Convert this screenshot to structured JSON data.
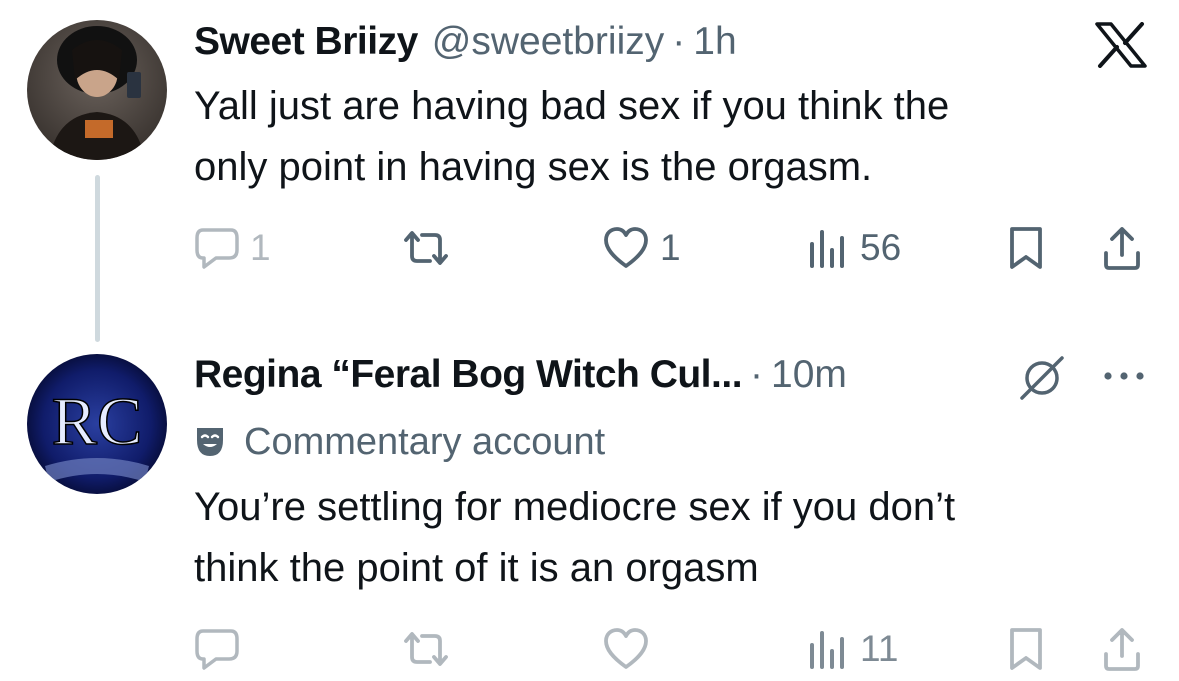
{
  "tweet1": {
    "name": "Sweet Briizy",
    "handle": "@sweetbriizy",
    "time": "1h",
    "text_line1": "Yall just are having bad sex if you think the",
    "text_line2": "only point in having sex is the orgasm.",
    "replies": "1",
    "likes": "1",
    "views": "56"
  },
  "tweet2": {
    "name": "Regina “Feral Bog Witch Cul...",
    "time": "10m",
    "badge": "Commentary account",
    "avatar_text": "RC",
    "text_line1": "You’re settling for mediocre sex if you don’t",
    "text_line2": "think the point of it is an orgasm",
    "views": "11"
  },
  "separator": "·",
  "icons": {
    "brand": "x-logo-icon",
    "reply": "speech-bubble-icon",
    "retweet": "retweet-arrows-icon",
    "like": "heart-icon",
    "views": "bar-chart-icon",
    "bookmark": "bookmark-icon",
    "share": "share-upload-icon",
    "muted": "slashed-circle-icon",
    "more": "ellipsis-icon",
    "commentary": "theater-mask-icon"
  },
  "colors": {
    "text": "#0f1419",
    "secondary": "#536471",
    "thread_line": "#cfd9de"
  }
}
